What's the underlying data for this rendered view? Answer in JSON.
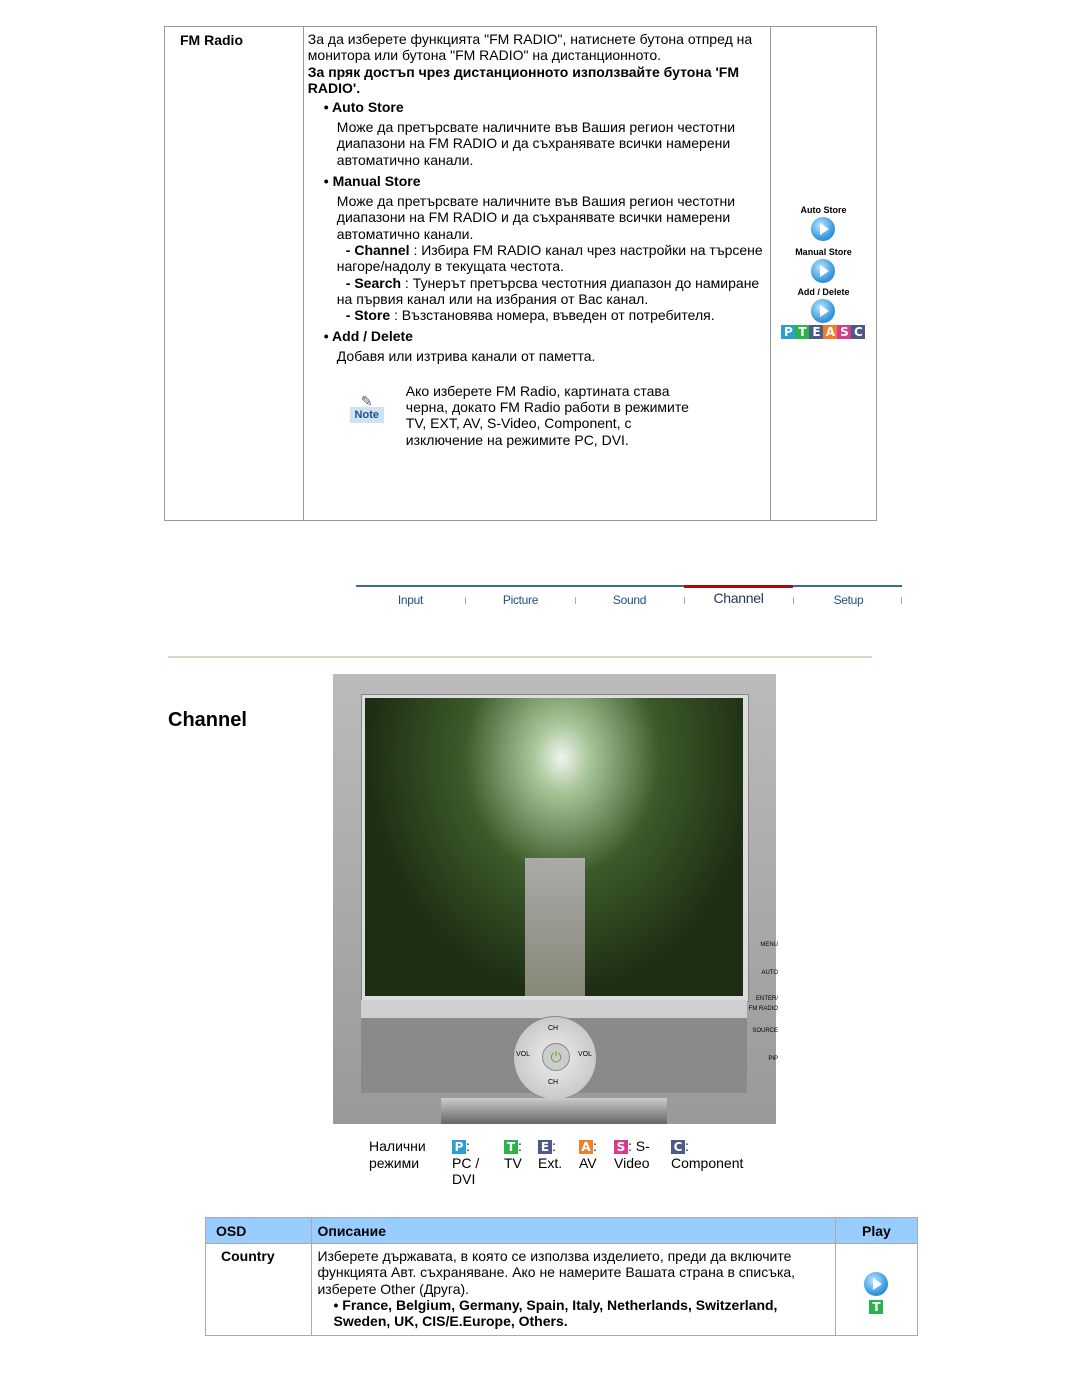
{
  "fm_section": {
    "label": "FM Radio",
    "intro": "За да изберете функцията \"FM RADIO\", натиснете бутона отпред на монитора или бутона \"FM RADIO\" на дистанционното.",
    "direct": "За пряк достъп чрез дистанционното използвайте бутона 'FM RADIO'.",
    "auto_store": {
      "title": "• Auto Store",
      "desc": "Може да претърсвате наличните във Вашия регион честотни диапазони на FM RADIO и да съхранявате всички намерени автоматично канали."
    },
    "manual_store": {
      "title": "• Manual Store",
      "desc": "Може да претърсвате наличните във Вашия регион честотни диапазони на FM RADIO и да съхранявате всички намерени автоматично канали.",
      "items": [
        {
          "key": "- Channel",
          "text": " : Избира FM RADIO канал чрез настройки на търсене нагоре/надолу в текущата честота."
        },
        {
          "key": "- Search",
          "text": " : Тунерът претърсва честотния диапазон до намиране на първия канал или на избрания от Вас канал."
        },
        {
          "key": "- Store",
          "text": " : Възстановява номера, въведен от потребителя."
        }
      ]
    },
    "add_delete": {
      "title": "• Add / Delete",
      "desc": "Добавя или изтрива канали от паметта."
    },
    "note_label": "Note",
    "note": "Ако изберете FM Radio, картината става черна, докато FM Radio работи в режимите TV, EXT, AV, S-Video, Component, с изключение на режимите PC, DVI.",
    "side": {
      "auto": "Auto Store",
      "manual": "Manual Store",
      "add": "Add / Delete",
      "modes": [
        "P",
        "T",
        "E",
        "A",
        "S",
        "C"
      ]
    }
  },
  "tabs": [
    {
      "label": "Input"
    },
    {
      "label": "Picture"
    },
    {
      "label": "Sound"
    },
    {
      "label": "Channel",
      "active": true
    },
    {
      "label": "Setup"
    }
  ],
  "colors": {
    "P": "#2a9fd6",
    "T": "#2db34a",
    "E": "#4b5a86",
    "A": "#f07f2a",
    "S": "#d83a8c",
    "C": "#4b5a86",
    "accent": "#a01010",
    "header": "#99ccff"
  },
  "page_title": "Channel",
  "monitor": {
    "labels": [
      "MENU",
      "AUTO",
      "ENTER/ FM RADIO",
      "SOURCE",
      "PIP",
      "CH",
      "VOL",
      "VOL",
      "CH"
    ]
  },
  "modes": {
    "label": "Налични режими",
    "items": [
      {
        "letter": "P",
        "text": ": PC / DVI"
      },
      {
        "letter": "T",
        "text": ": TV"
      },
      {
        "letter": "E",
        "text": ": Ext."
      },
      {
        "letter": "A",
        "text": ": AV"
      },
      {
        "letter": "S",
        "text": ": S-Video"
      },
      {
        "letter": "C",
        "text": ": Component"
      }
    ]
  },
  "osd_table": {
    "headers": [
      "OSD",
      "Описание",
      "Play"
    ],
    "rows": [
      {
        "osd": "Country",
        "desc": "Изберете държавата, в която се използва изделието, преди да включите функцията Авт. съхраняване. Ако не намерите Вашата страна в списъка, изберете Other (Друга).",
        "list": "• France, Belgium, Germany, Spain, Italy, Netherlands, Switzerland, Sweden, UK, CIS/E.Europe, Others.",
        "mode": "T"
      }
    ]
  }
}
